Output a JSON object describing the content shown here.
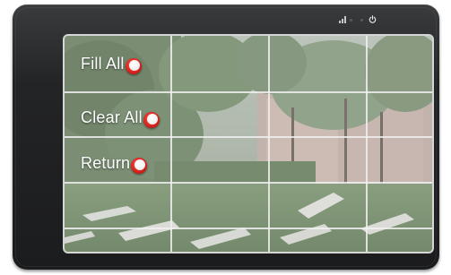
{
  "menu": {
    "fill_all": "Fill All",
    "clear_all": "Clear All",
    "return": "Return"
  },
  "status_bar": {
    "icons": [
      "signal-icon",
      "indicator-led",
      "indicator-led",
      "power-icon"
    ]
  },
  "grid": {
    "columns": 4,
    "rows": 5
  },
  "colors": {
    "device_bezel": "#1f2022",
    "grid_lines": "#f0f0f0",
    "knob_red": "#d4211c",
    "label_text": "#ffffff"
  }
}
